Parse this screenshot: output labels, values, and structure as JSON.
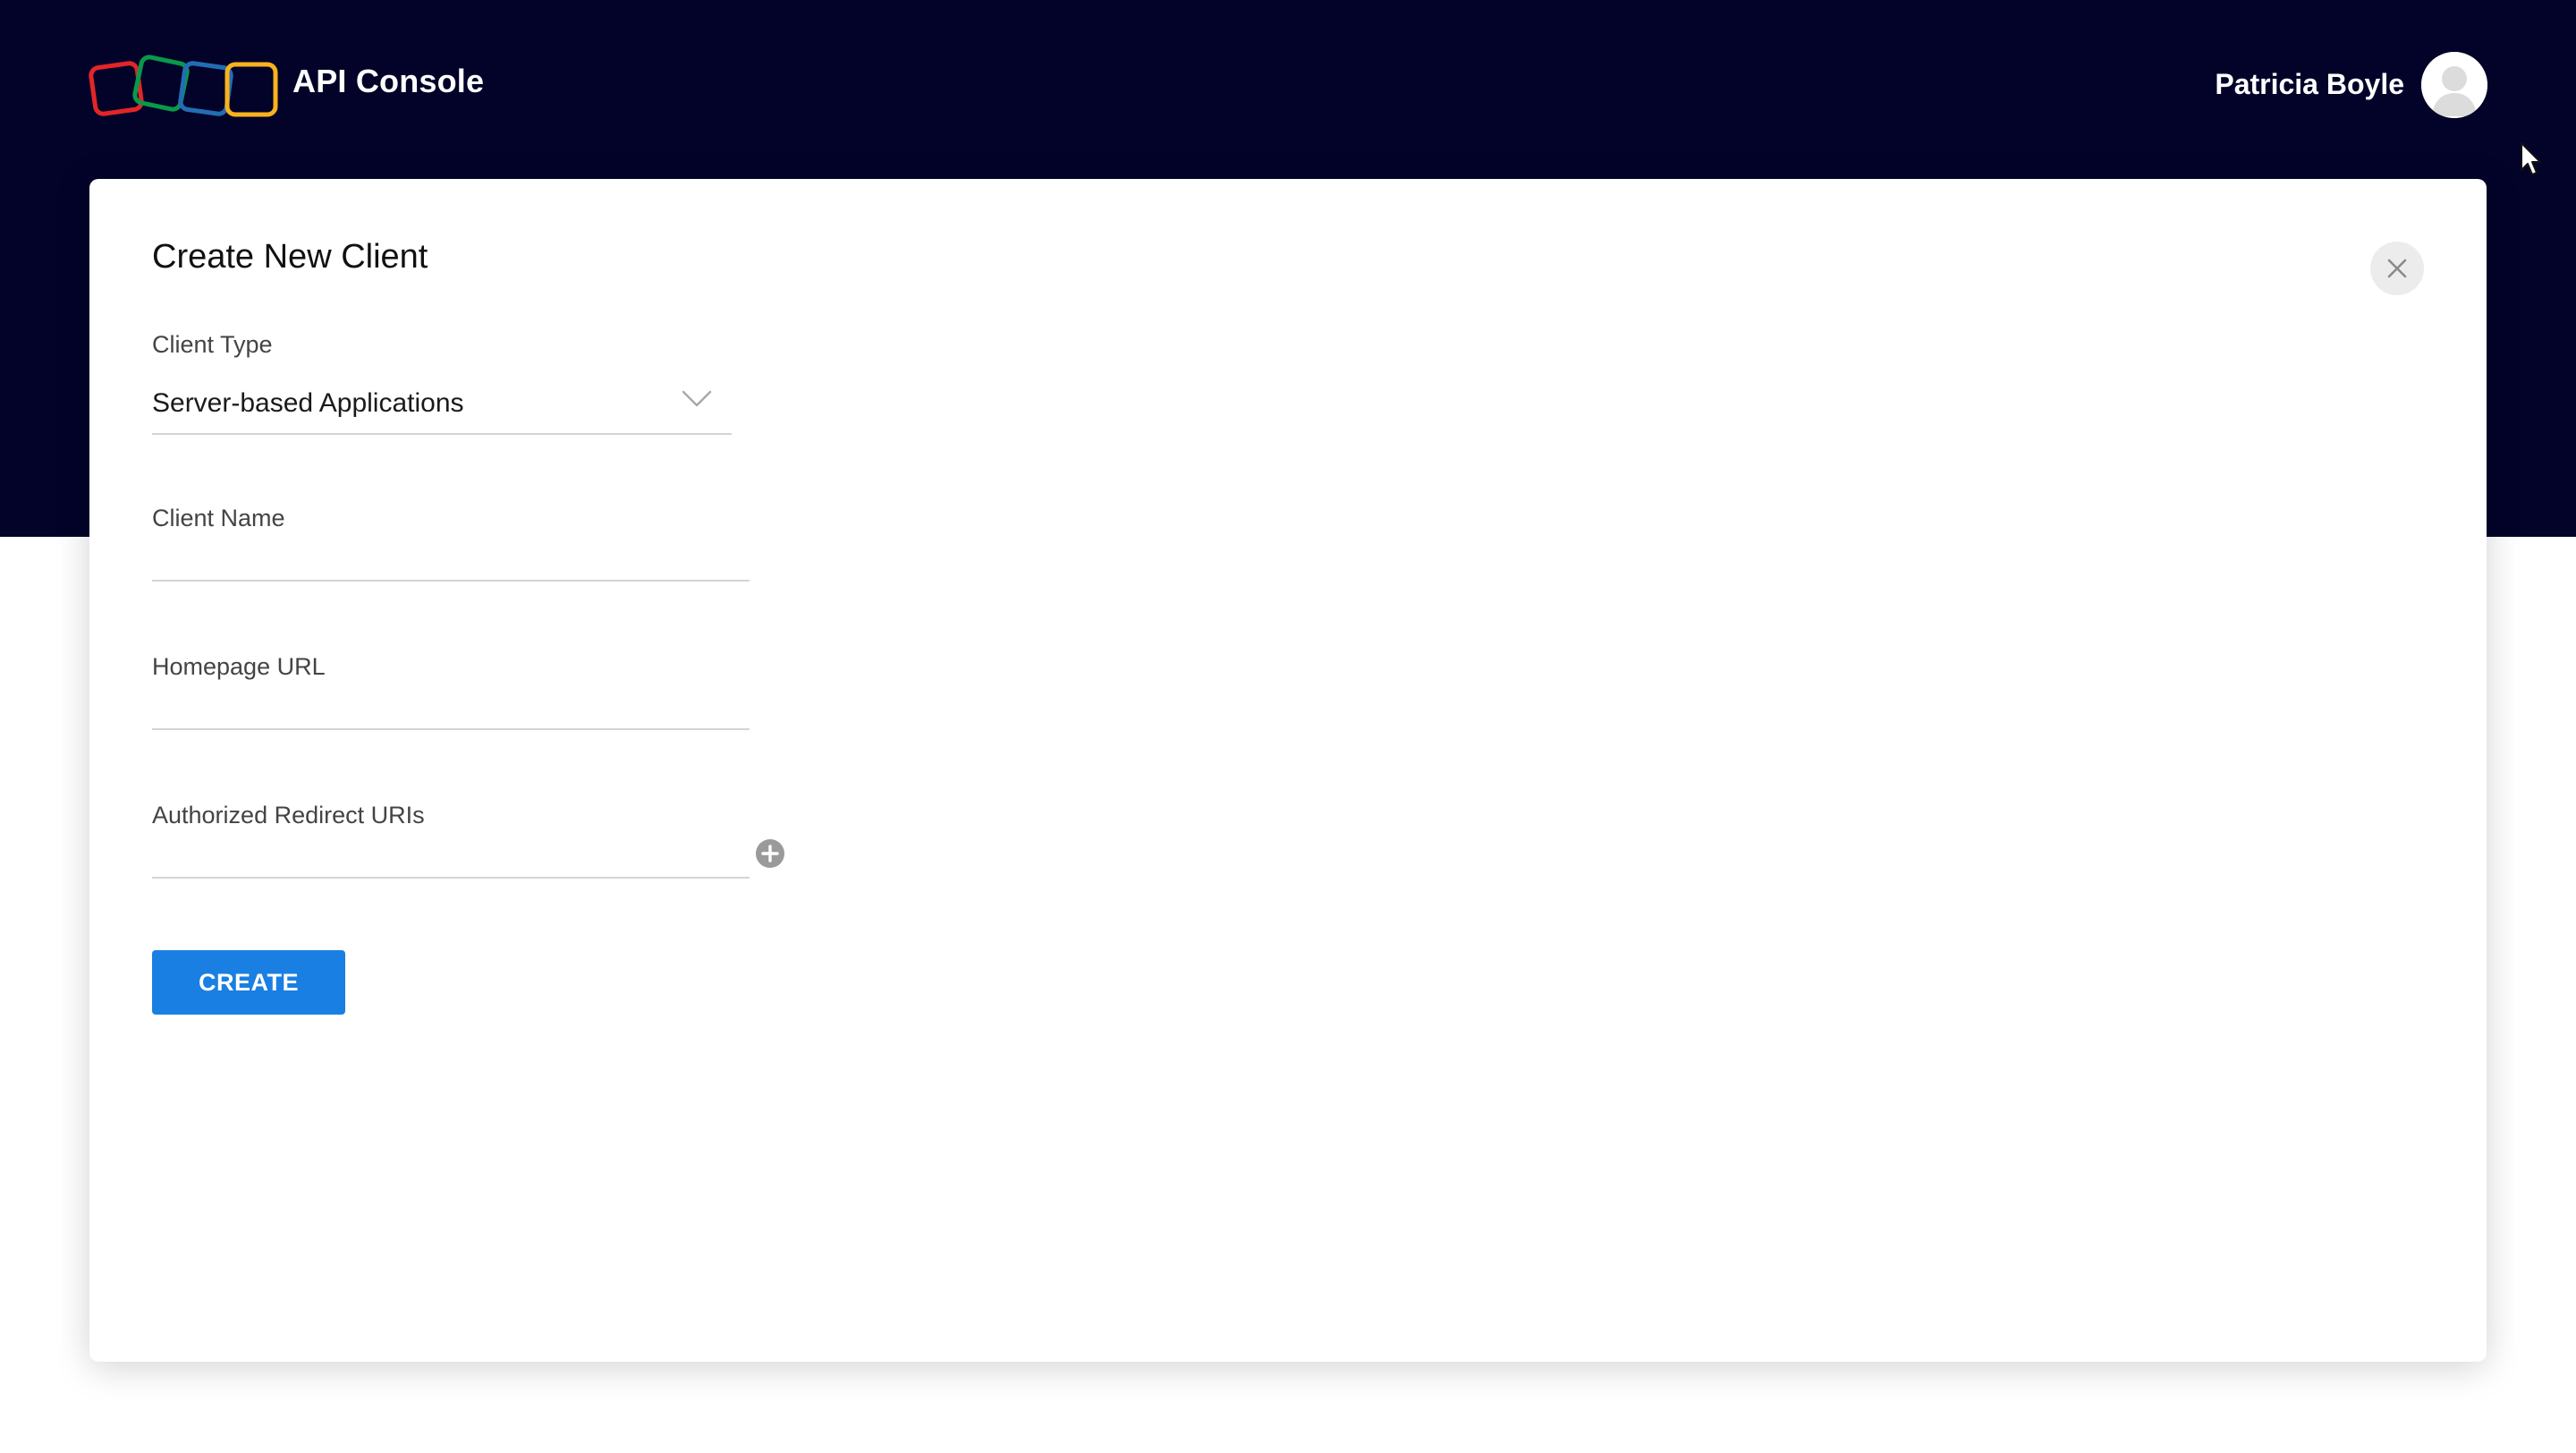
{
  "header": {
    "app_title": "API Console",
    "user_name": "Patricia Boyle",
    "logo_icon": "zoho-logo-icon",
    "avatar_icon": "user-avatar-icon"
  },
  "dialog": {
    "title": "Create New Client",
    "close_icon": "close-icon",
    "client_type": {
      "label": "Client Type",
      "value": "Server-based Applications",
      "icon": "chevron-down-icon"
    },
    "client_name": {
      "label": "Client Name",
      "value": ""
    },
    "homepage_url": {
      "label": "Homepage URL",
      "value": ""
    },
    "redirect_uris": {
      "label": "Authorized Redirect URIs",
      "value": "",
      "add_icon": "plus-circle-icon"
    },
    "create_label": "CREATE"
  },
  "colors": {
    "header_bg": "#03032a",
    "primary_button": "#1a7fe2",
    "logo_red": "#e42527",
    "logo_green": "#089949",
    "logo_blue": "#226db4",
    "logo_yellow": "#f9b21d"
  }
}
